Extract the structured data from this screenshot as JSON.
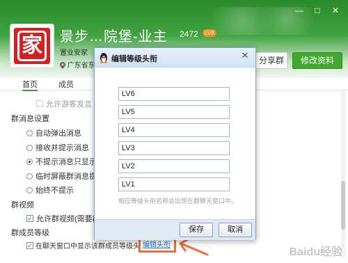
{
  "window": {
    "minimize": "—",
    "maximize": "□",
    "close": "✕"
  },
  "group": {
    "avatar_char": "家",
    "name": "景步…院堡-业主",
    "member_count": "2472",
    "level_badge": "LV8",
    "subtitle": "置业安家",
    "location": "广东省东…"
  },
  "header": {
    "share_label": "分享群",
    "edit_profile_label": "修改资料"
  },
  "tabs": [
    {
      "label": "首页"
    },
    {
      "label": "成员"
    }
  ],
  "settings": {
    "guest_label": "允许游客发言",
    "msg_section": "群消息设置",
    "msg_options": [
      {
        "label": "自动弹出消息",
        "checked": false
      },
      {
        "label": "接收并提示消息",
        "checked": false
      },
      {
        "label": "不提示消息只显示数",
        "checked": true
      },
      {
        "label": "临时屏蔽群消息提示",
        "checked": false
      },
      {
        "label": "始终不提示",
        "checked": false
      }
    ],
    "video_section": "群视频",
    "video_check": "允许群视频(需要群主",
    "level_section": "群成员等级",
    "level_check": "在聊天窗口中显示该群成员等级头",
    "level_check_suffix": "衔",
    "edit_title_link": "编辑头衔"
  },
  "dialog": {
    "title": "编辑等级头衔",
    "close": "✕",
    "levels": [
      "LV6",
      "LV5",
      "LV4",
      "LV3",
      "LV2",
      "LV1"
    ],
    "hint": "相应等级头衔名称会出现在群聊天窗口中。",
    "save_label": "保存",
    "cancel_label": "取消"
  },
  "watermark": "Baidu经验",
  "colors": {
    "brand_green": "#40a82e",
    "highlight": "#ef6d3b",
    "link": "#1e6ec8"
  }
}
